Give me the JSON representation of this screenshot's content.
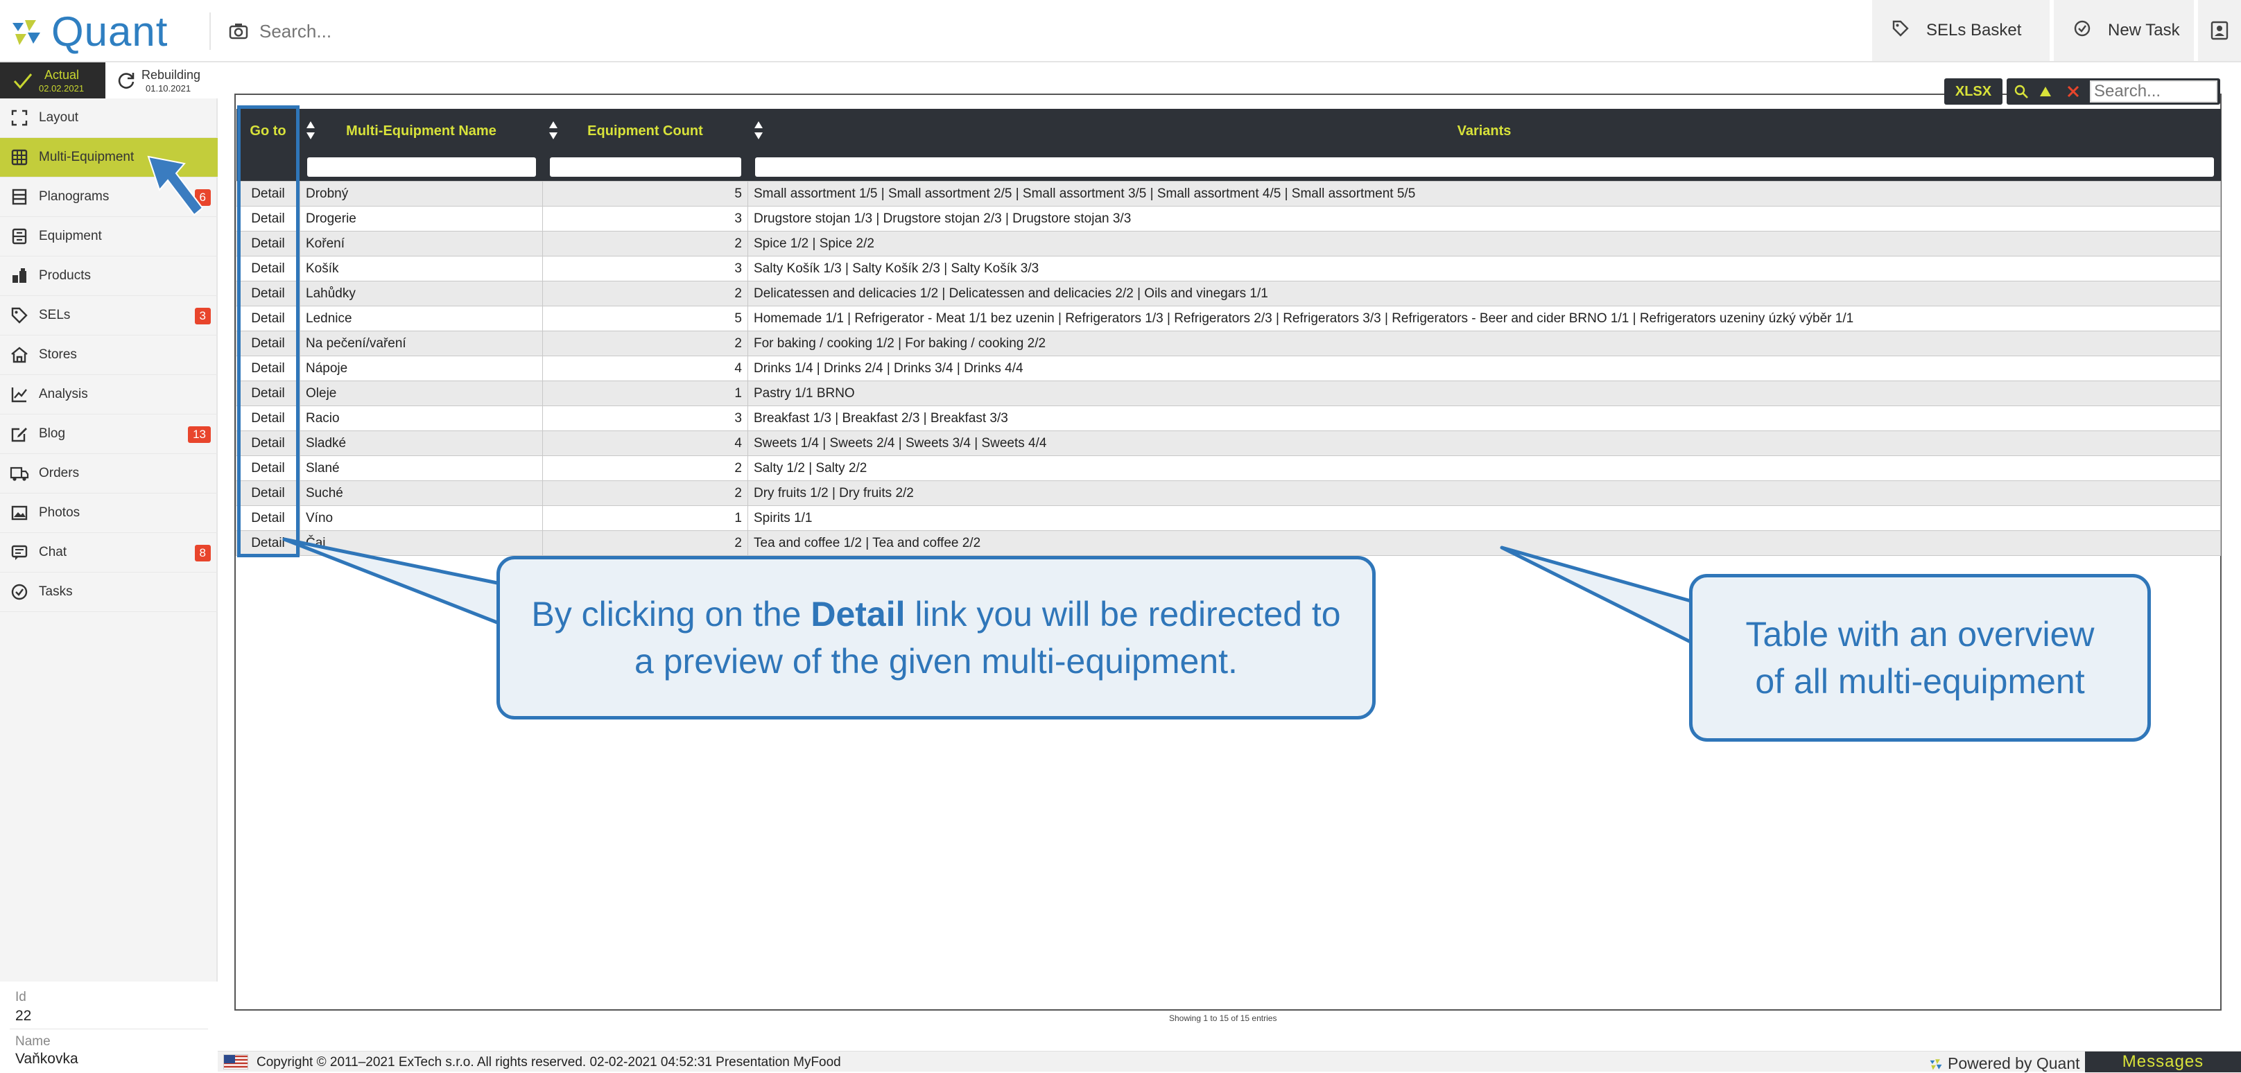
{
  "header": {
    "app_name": "Quant",
    "search_placeholder": "Search...",
    "sels_basket_label": "SELs Basket",
    "new_task_label": "New Task"
  },
  "sidebar": {
    "status": {
      "actual_label": "Actual",
      "actual_date": "02.02.2021",
      "rebuilding_label": "Rebuilding",
      "rebuilding_date": "01.10.2021"
    },
    "items": [
      {
        "label": "Layout",
        "icon": "layout-icon"
      },
      {
        "label": "Multi-Equipment",
        "icon": "grid-icon",
        "active": true
      },
      {
        "label": "Planograms",
        "icon": "shelves-icon",
        "badge": "6"
      },
      {
        "label": "Equipment",
        "icon": "equipment-icon"
      },
      {
        "label": "Products",
        "icon": "products-icon"
      },
      {
        "label": "SELs",
        "icon": "tag-icon",
        "badge": "3"
      },
      {
        "label": "Stores",
        "icon": "store-icon"
      },
      {
        "label": "Analysis",
        "icon": "chart-icon"
      },
      {
        "label": "Blog",
        "icon": "edit-icon",
        "badge": "13"
      },
      {
        "label": "Orders",
        "icon": "truck-icon"
      },
      {
        "label": "Photos",
        "icon": "image-icon"
      },
      {
        "label": "Chat",
        "icon": "chat-icon",
        "badge": "8"
      },
      {
        "label": "Tasks",
        "icon": "check-circle-icon"
      }
    ],
    "footer": {
      "id_label": "Id",
      "id_value": "22",
      "name_label": "Name",
      "name_value": "Vaňkovka"
    }
  },
  "toolbar": {
    "xlsx_label": "XLSX",
    "search_placeholder": "Search..."
  },
  "table": {
    "columns": [
      "Go to",
      "Multi-Equipment Name",
      "Equipment Count",
      "Variants"
    ],
    "rows": [
      {
        "goto": "Detail",
        "name": "Drobný",
        "count": "5",
        "variants": "Small assortment 1/5 | Small assortment 2/5 | Small assortment 3/5 | Small assortment 4/5 | Small assortment 5/5"
      },
      {
        "goto": "Detail",
        "name": "Drogerie",
        "count": "3",
        "variants": "Drugstore stojan 1/3 | Drugstore stojan 2/3 | Drugstore stojan 3/3"
      },
      {
        "goto": "Detail",
        "name": "Koření",
        "count": "2",
        "variants": "Spice 1/2 | Spice 2/2"
      },
      {
        "goto": "Detail",
        "name": "Košík",
        "count": "3",
        "variants": "Salty Košík 1/3 | Salty Košík 2/3 | Salty Košík 3/3"
      },
      {
        "goto": "Detail",
        "name": "Lahůdky",
        "count": "2",
        "variants": "Delicatessen and delicacies 1/2 | Delicatessen and delicacies 2/2 | Oils and vinegars 1/1"
      },
      {
        "goto": "Detail",
        "name": "Lednice",
        "count": "5",
        "variants": "Homemade 1/1 | Refrigerator - Meat 1/1 bez uzenin | Refrigerators 1/3 | Refrigerators 2/3 | Refrigerators 3/3 | Refrigerators - Beer and cider BRNO 1/1 | Refrigerators uzeniny úzký výběr 1/1"
      },
      {
        "goto": "Detail",
        "name": "Na pečení/vaření",
        "count": "2",
        "variants": "For baking / cooking 1/2 | For baking / cooking 2/2"
      },
      {
        "goto": "Detail",
        "name": "Nápoje",
        "count": "4",
        "variants": "Drinks 1/4 | Drinks 2/4 | Drinks 3/4 | Drinks 4/4"
      },
      {
        "goto": "Detail",
        "name": "Oleje",
        "count": "1",
        "variants": "Pastry 1/1 BRNO"
      },
      {
        "goto": "Detail",
        "name": "Racio",
        "count": "3",
        "variants": "Breakfast 1/3 | Breakfast 2/3 | Breakfast 3/3"
      },
      {
        "goto": "Detail",
        "name": "Sladké",
        "count": "4",
        "variants": "Sweets 1/4 | Sweets 2/4 | Sweets 3/4 | Sweets 4/4"
      },
      {
        "goto": "Detail",
        "name": "Slané",
        "count": "2",
        "variants": "Salty 1/2 | Salty 2/2"
      },
      {
        "goto": "Detail",
        "name": "Suché",
        "count": "2",
        "variants": "Dry fruits 1/2 | Dry fruits 2/2"
      },
      {
        "goto": "Detail",
        "name": "Víno",
        "count": "1",
        "variants": "Spirits 1/1"
      },
      {
        "goto": "Detail",
        "name": "Čaj",
        "count": "2",
        "variants": "Tea and coffee 1/2 | Tea and coffee 2/2"
      }
    ],
    "info": "Showing 1 to 15 of 15 entries"
  },
  "callouts": {
    "detail_before": "By clicking on the ",
    "detail_bold": "Detail",
    "detail_after": " link you will be redirected to a preview of the given multi-equipment.",
    "table_text": "Table with an overview of all multi-equipment"
  },
  "footer": {
    "copyright": "Copyright © 2011–2021 ExTech s.r.o. All rights reserved. 02-02-2021 04:52:31  Presentation MyFood",
    "powered": "Powered by Quant",
    "messages": "Messages"
  },
  "colors": {
    "accent": "#c3cd3b",
    "header_dark": "#2e3238",
    "header_text": "#d8e23a",
    "brand_blue": "#2f7fc1",
    "callout_blue": "#2f76b9",
    "badge_red": "#e8452c"
  }
}
